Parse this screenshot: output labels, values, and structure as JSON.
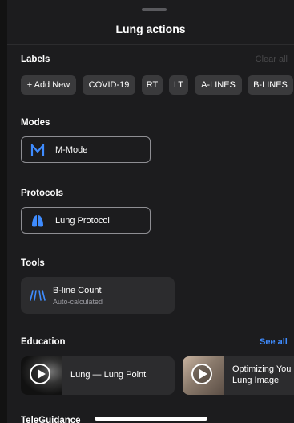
{
  "sheet": {
    "title": "Lung actions"
  },
  "labels": {
    "heading": "Labels",
    "clear_all": "Clear all",
    "chips": [
      "+ Add New",
      "COVID-19",
      "RT",
      "LT",
      "A-LINES",
      "B-LINES"
    ]
  },
  "modes": {
    "heading": "Modes",
    "item": "M-Mode"
  },
  "protocols": {
    "heading": "Protocols",
    "item": "Lung Protocol"
  },
  "tools": {
    "heading": "Tools",
    "item_title": "B-line Count",
    "item_subtitle": "Auto-calculated"
  },
  "education": {
    "heading": "Education",
    "see_all": "See all",
    "items": [
      {
        "label_line1": "Lung — Lung Point"
      },
      {
        "label_line1": "Optimizing You",
        "label_line2": "Lung Image"
      }
    ]
  },
  "teleguidance": {
    "heading": "TeleGuidance"
  },
  "colors": {
    "accent": "#3f8cff",
    "background": "#1c1c1e",
    "card": "#2c2c2e",
    "chip": "#3a3a3c",
    "muted": "#48484a"
  }
}
